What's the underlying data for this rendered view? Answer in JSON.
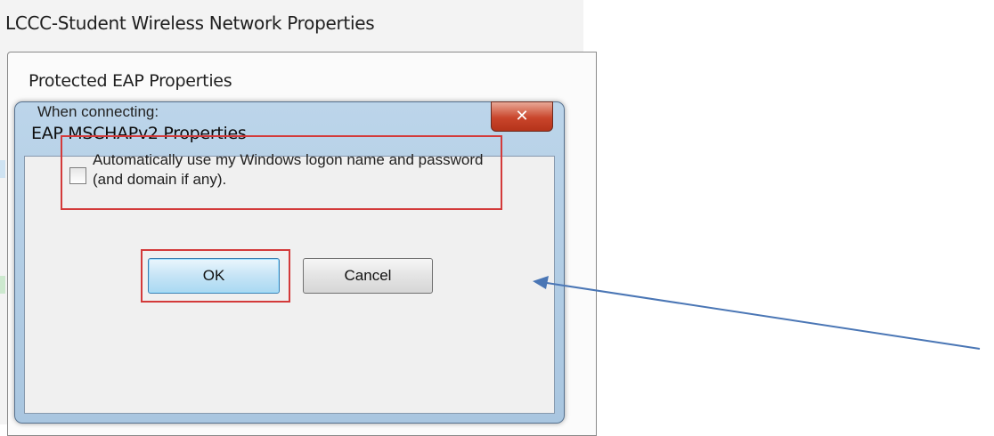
{
  "background_window": {
    "title": "LCCC-Student Wireless Network Properties"
  },
  "peap_window": {
    "title": "Protected EAP Properties"
  },
  "dialog": {
    "title": "EAP MSCHAPv2 Properties",
    "close_icon": "close-icon",
    "when_connecting_label": "When connecting:",
    "checkbox": {
      "label": "Automatically use my Windows logon name and password (and domain if any).",
      "checked": false
    },
    "ok_label": "OK",
    "cancel_label": "Cancel"
  },
  "colors": {
    "highlight": "#d33a3a",
    "arrow": "#4a76b5",
    "dialog_frame": "#bcd5ea",
    "close_button": "#c9452b"
  }
}
